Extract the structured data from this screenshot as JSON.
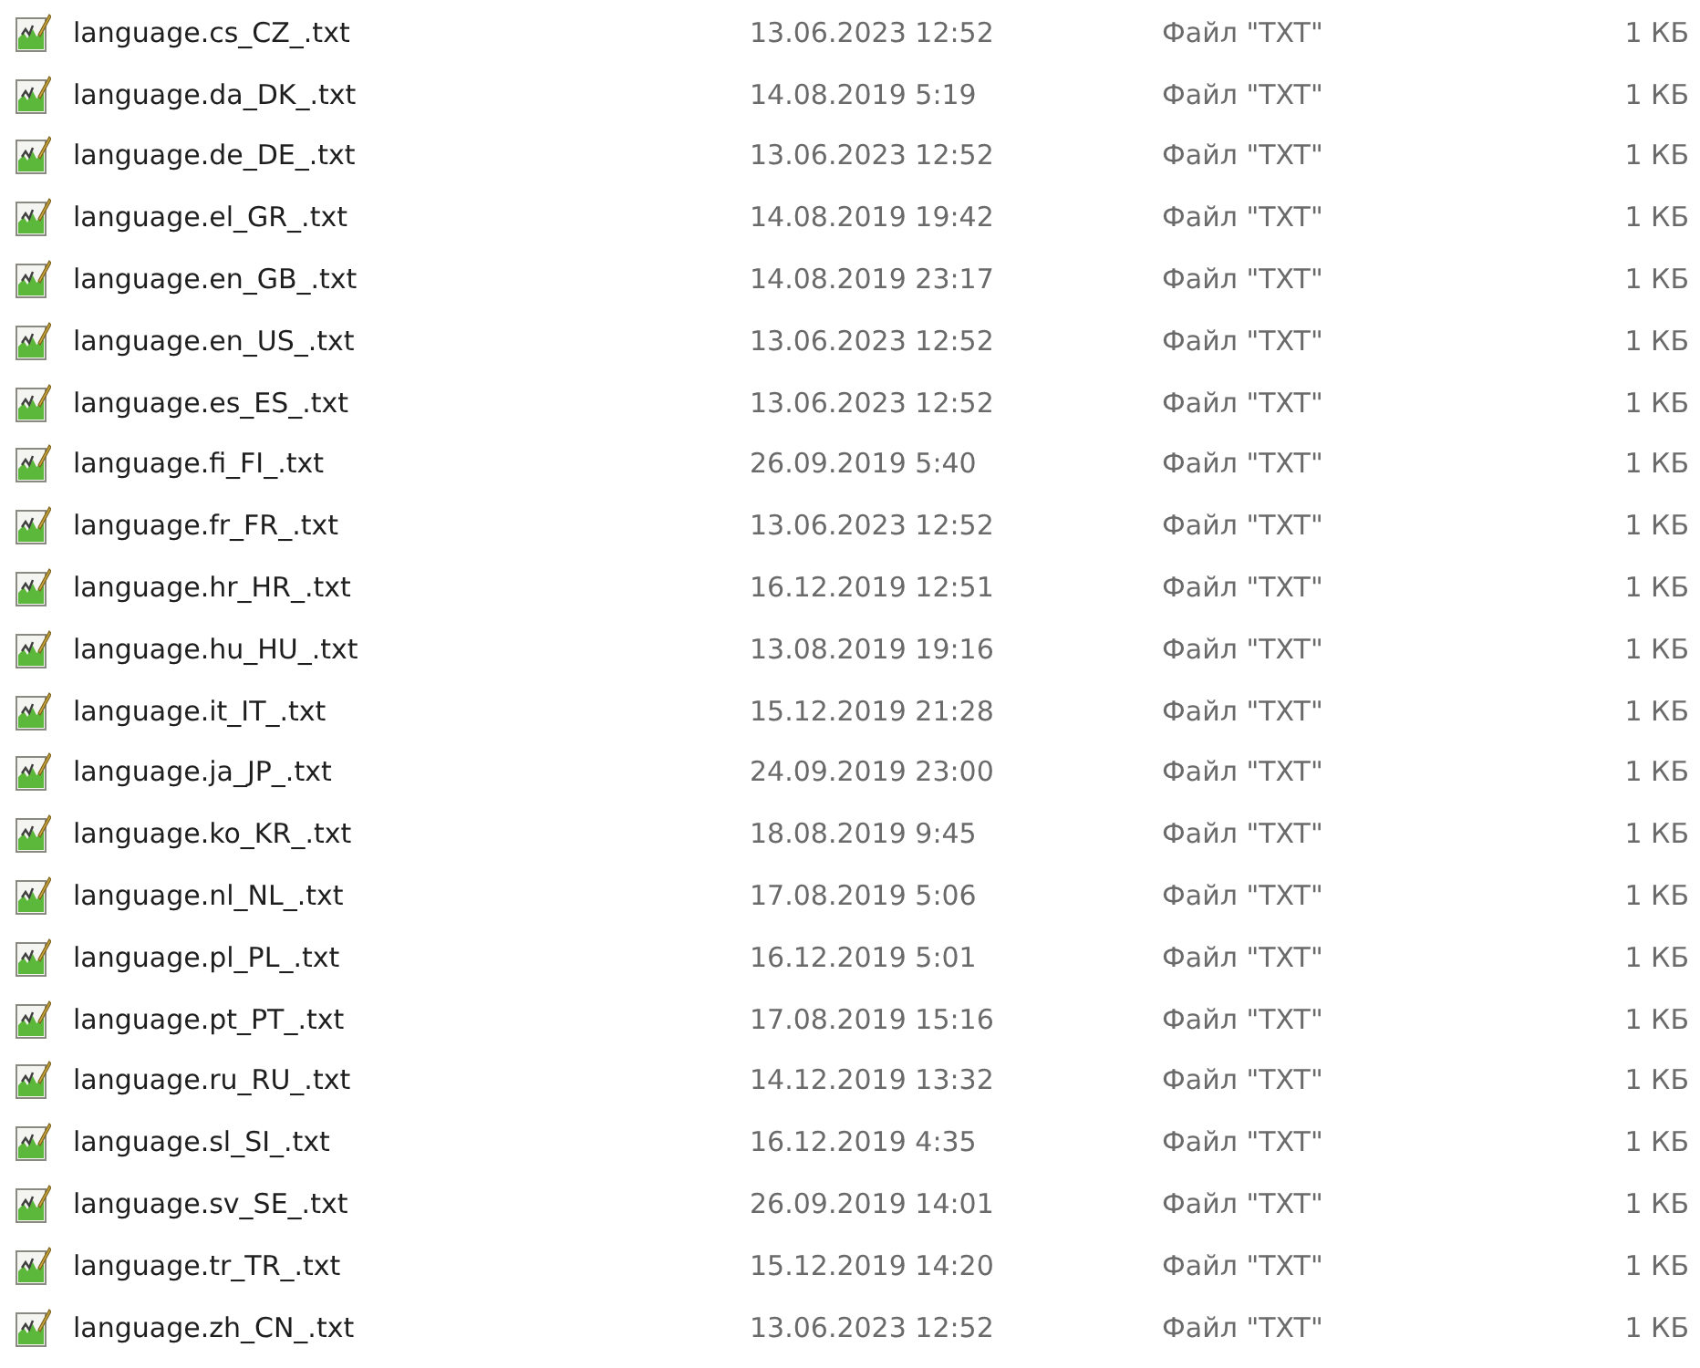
{
  "files": [
    {
      "name": "language.cs_CZ_.txt",
      "modified": "13.06.2023 12:52",
      "type": "Файл \"TXT\"",
      "size": "1 КБ"
    },
    {
      "name": "language.da_DK_.txt",
      "modified": "14.08.2019 5:19",
      "type": "Файл \"TXT\"",
      "size": "1 КБ"
    },
    {
      "name": "language.de_DE_.txt",
      "modified": "13.06.2023 12:52",
      "type": "Файл \"TXT\"",
      "size": "1 КБ"
    },
    {
      "name": "language.el_GR_.txt",
      "modified": "14.08.2019 19:42",
      "type": "Файл \"TXT\"",
      "size": "1 КБ"
    },
    {
      "name": "language.en_GB_.txt",
      "modified": "14.08.2019 23:17",
      "type": "Файл \"TXT\"",
      "size": "1 КБ"
    },
    {
      "name": "language.en_US_.txt",
      "modified": "13.06.2023 12:52",
      "type": "Файл \"TXT\"",
      "size": "1 КБ"
    },
    {
      "name": "language.es_ES_.txt",
      "modified": "13.06.2023 12:52",
      "type": "Файл \"TXT\"",
      "size": "1 КБ"
    },
    {
      "name": "language.fi_FI_.txt",
      "modified": "26.09.2019 5:40",
      "type": "Файл \"TXT\"",
      "size": "1 КБ"
    },
    {
      "name": "language.fr_FR_.txt",
      "modified": "13.06.2023 12:52",
      "type": "Файл \"TXT\"",
      "size": "1 КБ"
    },
    {
      "name": "language.hr_HR_.txt",
      "modified": "16.12.2019 12:51",
      "type": "Файл \"TXT\"",
      "size": "1 КБ"
    },
    {
      "name": "language.hu_HU_.txt",
      "modified": "13.08.2019 19:16",
      "type": "Файл \"TXT\"",
      "size": "1 КБ"
    },
    {
      "name": "language.it_IT_.txt",
      "modified": "15.12.2019 21:28",
      "type": "Файл \"TXT\"",
      "size": "1 КБ"
    },
    {
      "name": "language.ja_JP_.txt",
      "modified": "24.09.2019 23:00",
      "type": "Файл \"TXT\"",
      "size": "1 КБ"
    },
    {
      "name": "language.ko_KR_.txt",
      "modified": "18.08.2019 9:45",
      "type": "Файл \"TXT\"",
      "size": "1 КБ"
    },
    {
      "name": "language.nl_NL_.txt",
      "modified": "17.08.2019 5:06",
      "type": "Файл \"TXT\"",
      "size": "1 КБ"
    },
    {
      "name": "language.pl_PL_.txt",
      "modified": "16.12.2019 5:01",
      "type": "Файл \"TXT\"",
      "size": "1 КБ"
    },
    {
      "name": "language.pt_PT_.txt",
      "modified": "17.08.2019 15:16",
      "type": "Файл \"TXT\"",
      "size": "1 КБ"
    },
    {
      "name": "language.ru_RU_.txt",
      "modified": "14.12.2019 13:32",
      "type": "Файл \"TXT\"",
      "size": "1 КБ"
    },
    {
      "name": "language.sl_SI_.txt",
      "modified": "16.12.2019 4:35",
      "type": "Файл \"TXT\"",
      "size": "1 КБ"
    },
    {
      "name": "language.sv_SE_.txt",
      "modified": "26.09.2019 14:01",
      "type": "Файл \"TXT\"",
      "size": "1 КБ"
    },
    {
      "name": "language.tr_TR_.txt",
      "modified": "15.12.2019 14:20",
      "type": "Файл \"TXT\"",
      "size": "1 КБ"
    },
    {
      "name": "language.zh_CN_.txt",
      "modified": "13.06.2023 12:52",
      "type": "Файл \"TXT\"",
      "size": "1 КБ"
    }
  ]
}
